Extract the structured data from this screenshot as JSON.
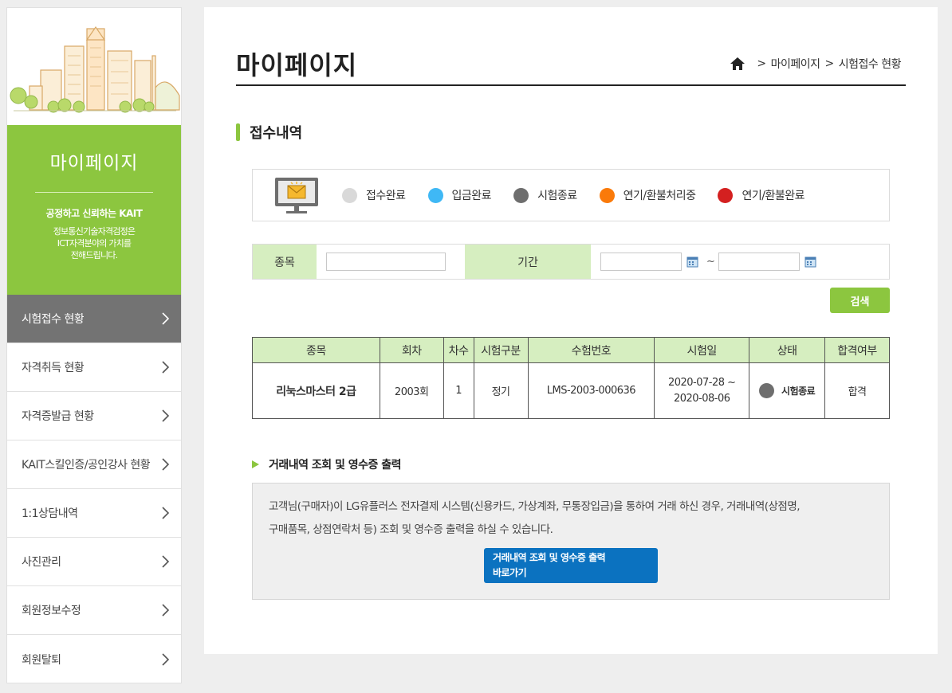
{
  "sidebar": {
    "title": "마이페이지",
    "slogan": "공정하고 신뢰하는 KAIT",
    "desc_line1": "정보통신기술자격검정은",
    "desc_line2": "ICT자격분야의 가치를",
    "desc_line3": "전해드립니다.",
    "items": [
      {
        "label": "시험접수 현황",
        "active": true
      },
      {
        "label": "자격취득 현황"
      },
      {
        "label": "자격증발급 현황"
      },
      {
        "label": "KAIT스킬인증/공인강사 현황"
      },
      {
        "label": "1:1상담내역"
      },
      {
        "label": "사진관리"
      },
      {
        "label": "회원정보수정"
      },
      {
        "label": "회원탈퇴"
      }
    ]
  },
  "header": {
    "title": "마이페이지",
    "breadcrumb": [
      "마이페이지",
      "시험접수 현황"
    ],
    "separator": ">"
  },
  "section": {
    "title": "접수내역"
  },
  "legend": [
    {
      "label": "접수완료",
      "color": "#d9d9d9"
    },
    {
      "label": "입금완료",
      "color": "#3fb8f5"
    },
    {
      "label": "시험종료",
      "color": "#6e6e6e"
    },
    {
      "label": "연기/환불처리중",
      "color": "#fa7a0a"
    },
    {
      "label": "연기/환불완료",
      "color": "#d42020"
    }
  ],
  "search": {
    "subject_label": "종목",
    "subject_value": "",
    "period_label": "기간",
    "start_value": "",
    "end_value": "",
    "tilde": "~",
    "button": "검색"
  },
  "table": {
    "headers": [
      "종목",
      "회차",
      "차수",
      "시험구분",
      "수험번호",
      "시험일",
      "상태",
      "합격여부"
    ],
    "rows": [
      {
        "subject": "리눅스마스터 2급",
        "round": "2003회",
        "order": "1",
        "type": "정기",
        "exam_no": "LMS-2003-000636",
        "date_start": "2020-07-28 ~",
        "date_end": "2020-08-06",
        "status": "시험종료",
        "result": "합격"
      }
    ]
  },
  "receipt": {
    "title": "거래내역 조회 및 영수증 출력",
    "text_line1": "고객님(구매자)이 LG유플러스 전자결제 시스템(신용카드, 가상계좌, 무통장입금)을 통하여 거래 하신 경우, 거래내역(상점명,",
    "text_line2": "구매품목, 상점연락처 등) 조회 및 영수증 출력을 하실 수 있습니다.",
    "button_line1": "거래내역 조회 및 영수증 출력",
    "button_line2": "바로가기"
  },
  "colors": {
    "accent": "#8cc63f",
    "header_bg": "#d6eec0",
    "button_blue": "#0b72c0",
    "active_menu": "#737373"
  }
}
